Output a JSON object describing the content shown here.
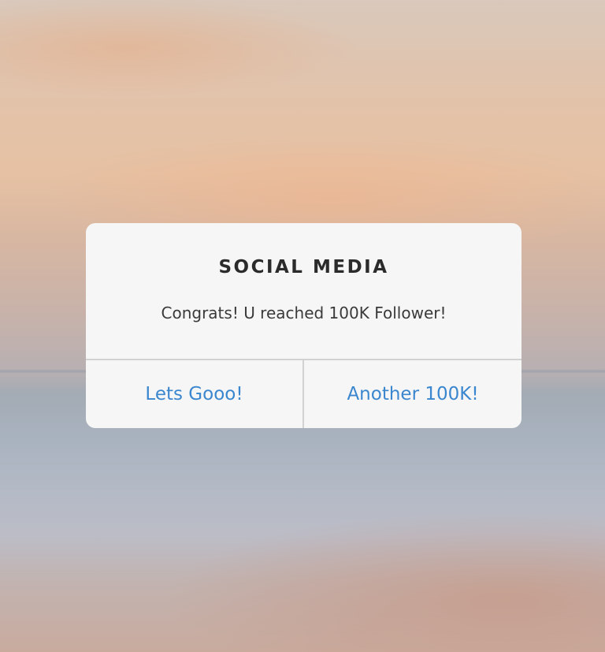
{
  "dialog": {
    "title": "SOCIAL MEDIA",
    "message": "Congrats! U reached 100K Follower!",
    "buttons": {
      "primary_label": "Lets Gooo!",
      "secondary_label": "Another 100K!"
    }
  },
  "colors": {
    "dialog_background": "#f6f6f6",
    "title_text": "#2b2b2b",
    "message_text": "#3a3a3a",
    "button_text": "#3a86cf",
    "divider": "#d2d2d2"
  }
}
